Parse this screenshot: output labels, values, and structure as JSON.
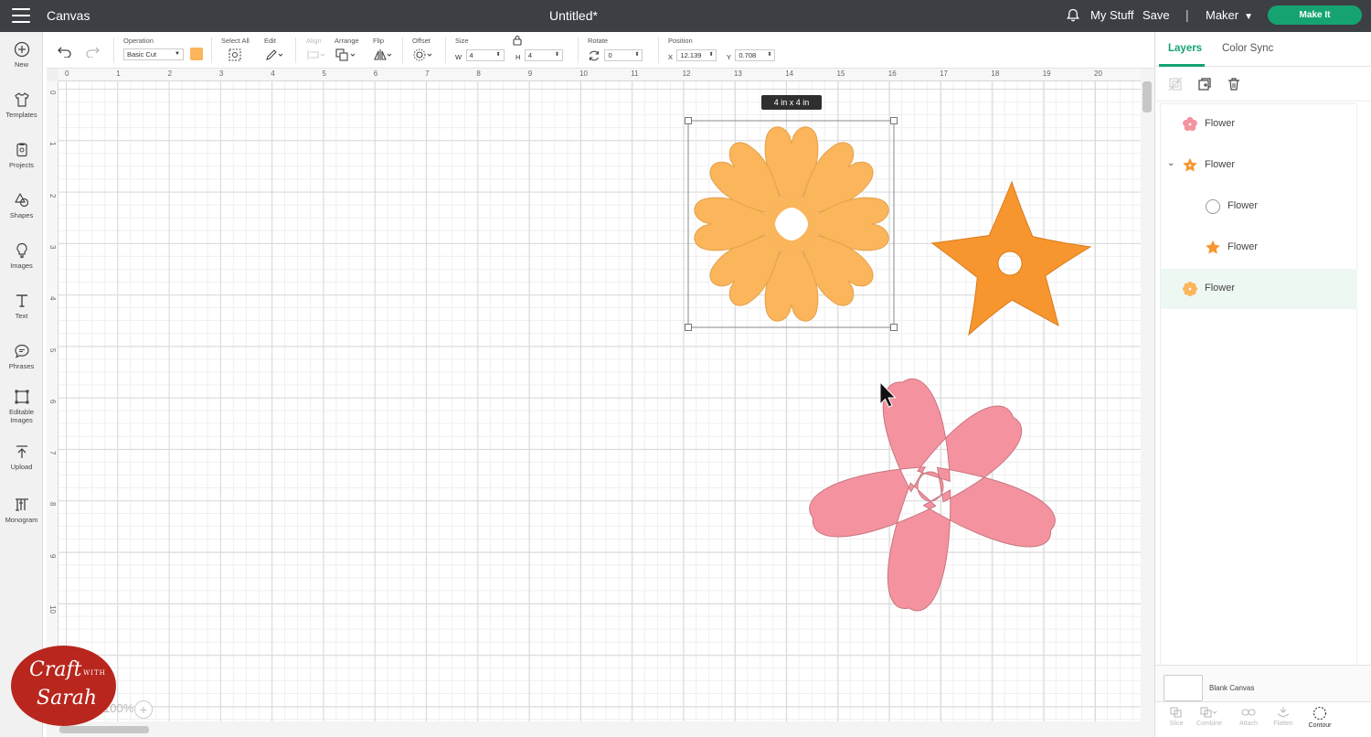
{
  "topbar": {
    "app_name": "Canvas",
    "doc_title": "Untitled*",
    "my_stuff": "My Stuff",
    "save": "Save",
    "separator": "|",
    "machine": "Maker",
    "make_it": "Make It",
    "make_it_color": "#15a471"
  },
  "sidebar": {
    "items": [
      {
        "label": "New",
        "icon": "plus-circle-icon"
      },
      {
        "label": "Templates",
        "icon": "shirt-icon"
      },
      {
        "label": "Projects",
        "icon": "projects-icon"
      },
      {
        "label": "Shapes",
        "icon": "shapes-icon"
      },
      {
        "label": "Images",
        "icon": "lightbulb-icon"
      },
      {
        "label": "Text",
        "icon": "text-icon"
      },
      {
        "label": "Phrases",
        "icon": "speech-bubble-icon"
      },
      {
        "label": "Editable Images",
        "icon": "editable-images-icon"
      },
      {
        "label": "Upload",
        "icon": "upload-icon"
      },
      {
        "label": "Monogram",
        "icon": "monogram-icon"
      }
    ]
  },
  "toolbar": {
    "operation_label": "Operation",
    "operation_value": "Basic Cut",
    "color_swatch": "#fbb55a",
    "select_all_label": "Select All",
    "edit_label": "Edit",
    "align_label": "Align",
    "arrange_label": "Arrange",
    "flip_label": "Flip",
    "offset_label": "Offset",
    "size_label": "Size",
    "w_label": "W",
    "w_value": "4",
    "h_label": "H",
    "h_value": "4",
    "rotate_label": "Rotate",
    "rotate_value": "0",
    "position_label": "Position",
    "x_label": "X",
    "x_value": "12.139",
    "y_label": "Y",
    "y_value": "0.708"
  },
  "rulers": {
    "top": [
      "0",
      "1",
      "2",
      "3",
      "4",
      "5",
      "6",
      "7",
      "8",
      "9",
      "10",
      "11",
      "12",
      "13",
      "14",
      "15",
      "16",
      "17",
      "18",
      "19",
      "20"
    ],
    "left": [
      "0",
      "1",
      "2",
      "3",
      "4",
      "5",
      "6",
      "7",
      "8",
      "9",
      "10"
    ]
  },
  "canvas": {
    "size_tag": "4 in x 4 in",
    "shapes": [
      {
        "name": "daisy",
        "color": "#fbb55a"
      },
      {
        "name": "star-flower",
        "color": "#f7962e"
      },
      {
        "name": "pink-flower",
        "color": "#f4939f"
      }
    ]
  },
  "rpanel": {
    "tab_layers": "Layers",
    "tab_color_sync": "Color Sync",
    "layers": [
      {
        "name": "Flower",
        "icon": "pink-flower-icon",
        "color": "#f4939f"
      },
      {
        "name": "Flower",
        "icon": "orange-star-flower-icon",
        "color": "#f7962e",
        "expanded": true
      },
      {
        "name": "Flower",
        "icon": "circle-outline-icon",
        "color": "#ffffff"
      },
      {
        "name": "Flower",
        "icon": "orange-star-icon",
        "color": "#f7962e"
      },
      {
        "name": "Flower",
        "icon": "daisy-icon",
        "color": "#fbb55a",
        "selected": true
      }
    ],
    "blank_canvas": "Blank Canvas",
    "bottom_tools": [
      "Slice",
      "Combine",
      "Attach",
      "Flatten",
      "Contour"
    ]
  },
  "zoom": {
    "value": "100%"
  },
  "logo": {
    "line1": "Craft",
    "line1_small": "WITH",
    "line2": "Sarah"
  }
}
